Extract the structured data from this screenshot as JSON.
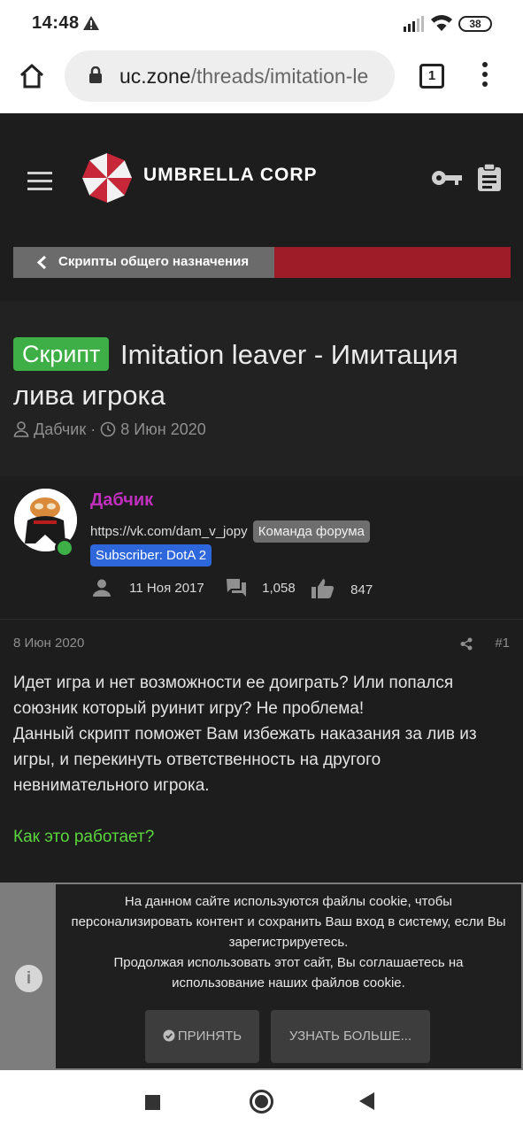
{
  "status_bar": {
    "time": "14:48",
    "battery": "38"
  },
  "browser": {
    "url_host": "uc.zone",
    "url_path": "/threads/imitation-le",
    "tab_count": "1"
  },
  "site": {
    "brand": "UMBRELLA CORP"
  },
  "breadcrumb": {
    "label": "Скрипты общего назначения"
  },
  "thread": {
    "prefix": "Скрипт",
    "title": "Imitation leaver - Имитация лива игрока",
    "author": "Дабчик",
    "date": "8 Июн 2020",
    "separator": "·"
  },
  "author_card": {
    "name": "Дабчик",
    "user_title": "https://vk.com/dam_v_jopy",
    "banner_team": "Команда форума",
    "banner_sub": "Subscriber: DotA 2",
    "joined": "11 Ноя 2017",
    "messages": "1,058",
    "reactions": "847"
  },
  "post": {
    "date": "8 Июн 2020",
    "number": "#1",
    "lines": [
      "Идет игра и нет возможности ее доиграть? Или попался союзник который руинит игру? Не проблема!",
      "Данный скрипт поможет Вам избежать наказания за лив из игры, и перекинуть ответственность на другого невнимательного игрока."
    ],
    "heading": "Как это работает?"
  },
  "cookie": {
    "message_1": "На данном сайте используются файлы cookie, чтобы персонализировать контент и сохранить Ваш вход в систему, если Вы зарегистрируетесь.",
    "message_2": "Продолжая использовать этот сайт, Вы соглашаетесь на использование наших файлов cookie.",
    "accept": "ПРИНЯТЬ",
    "learn_more": "УЗНАТЬ БОЛЬШЕ...",
    "info_glyph": "i"
  },
  "colors": {
    "prefix_green": "#3eaf47",
    "breadcrumb_red": "#9e1c27",
    "username_purple": "#c02fbd",
    "banner_blue": "#2d67db",
    "heading_green": "#5bd63e"
  },
  "icons": [
    "warning-icon",
    "signal-icon",
    "wifi-icon",
    "battery-icon",
    "home-icon",
    "lock-icon",
    "tabs-icon",
    "more-icon",
    "menu-icon",
    "umbrella-logo-icon",
    "key-icon",
    "clipboard-icon",
    "chevron-left-icon",
    "user-icon",
    "clock-icon",
    "comments-icon",
    "thumbs-up-icon",
    "share-icon",
    "info-icon",
    "check-circle-icon"
  ]
}
